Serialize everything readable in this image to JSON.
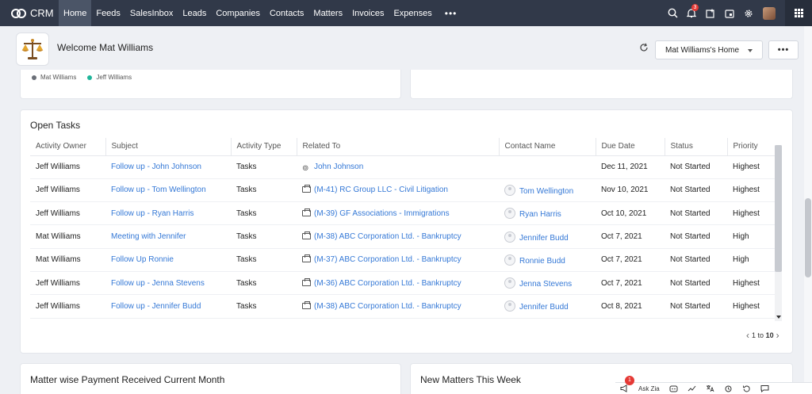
{
  "app": {
    "name": "CRM"
  },
  "nav": {
    "tabs": [
      {
        "label": "Home",
        "active": true
      },
      {
        "label": "Feeds"
      },
      {
        "label": "SalesInbox"
      },
      {
        "label": "Leads"
      },
      {
        "label": "Companies"
      },
      {
        "label": "Contacts"
      },
      {
        "label": "Matters"
      },
      {
        "label": "Invoices"
      },
      {
        "label": "Expenses"
      }
    ],
    "more_label": "•••",
    "notification_count": "3"
  },
  "welcome": {
    "title": "Welcome Mat Williams",
    "home_select": "Mat Williams's Home",
    "more_label": "•••"
  },
  "top_chart_legend": [
    {
      "label": "Mat Williams",
      "color": "#6b6f78"
    },
    {
      "label": "Jeff Williams",
      "color": "#1fb59a"
    }
  ],
  "open_tasks": {
    "title": "Open Tasks",
    "columns": [
      "Activity Owner",
      "Subject",
      "Activity Type",
      "Related To",
      "Contact Name",
      "Due Date",
      "Status",
      "Priority"
    ],
    "rows": [
      {
        "owner": "Jeff Williams",
        "subject": "Follow up - John Johnson",
        "type": "Tasks",
        "related": "John Johnson",
        "related_kind": "contact",
        "contact": "",
        "due": "Dec 11, 2021",
        "status": "Not Started",
        "priority": "Highest"
      },
      {
        "owner": "Jeff Williams",
        "subject": "Follow up - Tom Wellington",
        "type": "Tasks",
        "related": "(M-41) RC Group LLC - Civil Litigation",
        "related_kind": "matter",
        "contact": "Tom Wellington",
        "due": "Nov 10, 2021",
        "status": "Not Started",
        "priority": "Highest"
      },
      {
        "owner": "Jeff Williams",
        "subject": "Follow up - Ryan Harris",
        "type": "Tasks",
        "related": "(M-39) GF Associations - Immigrations",
        "related_kind": "matter",
        "contact": "Ryan Harris",
        "due": "Oct 10, 2021",
        "status": "Not Started",
        "priority": "Highest"
      },
      {
        "owner": "Mat Williams",
        "subject": "Meeting with Jennifer",
        "type": "Tasks",
        "related": "(M-38) ABC Corporation Ltd. - Bankruptcy",
        "related_kind": "matter",
        "contact": "Jennifer Budd",
        "due": "Oct 7, 2021",
        "status": "Not Started",
        "priority": "High"
      },
      {
        "owner": "Mat Williams",
        "subject": "Follow Up Ronnie",
        "type": "Tasks",
        "related": "(M-37) ABC Corporation Ltd. - Bankruptcy",
        "related_kind": "matter",
        "contact": "Ronnie Budd",
        "due": "Oct 7, 2021",
        "status": "Not Started",
        "priority": "High"
      },
      {
        "owner": "Jeff Williams",
        "subject": "Follow up - Jenna Stevens",
        "type": "Tasks",
        "related": "(M-36) ABC Corporation Ltd. - Bankruptcy",
        "related_kind": "matter",
        "contact": "Jenna Stevens",
        "due": "Oct 7, 2021",
        "status": "Not Started",
        "priority": "Highest"
      },
      {
        "owner": "Jeff Williams",
        "subject": "Follow up - Jennifer Budd",
        "type": "Tasks",
        "related": "(M-38) ABC Corporation Ltd. - Bankruptcy",
        "related_kind": "matter",
        "contact": "Jennifer Budd",
        "due": "Oct 8, 2021",
        "status": "Not Started",
        "priority": "Highest"
      }
    ],
    "pager": {
      "start": "1",
      "sep": "to",
      "end": "10"
    }
  },
  "bottom_cards": {
    "left_title": "Matter wise Payment Received Current Month",
    "right_title": "New Matters This Week"
  },
  "bottom_bar": {
    "badge": "1",
    "ask_zia": "Ask Zia"
  }
}
